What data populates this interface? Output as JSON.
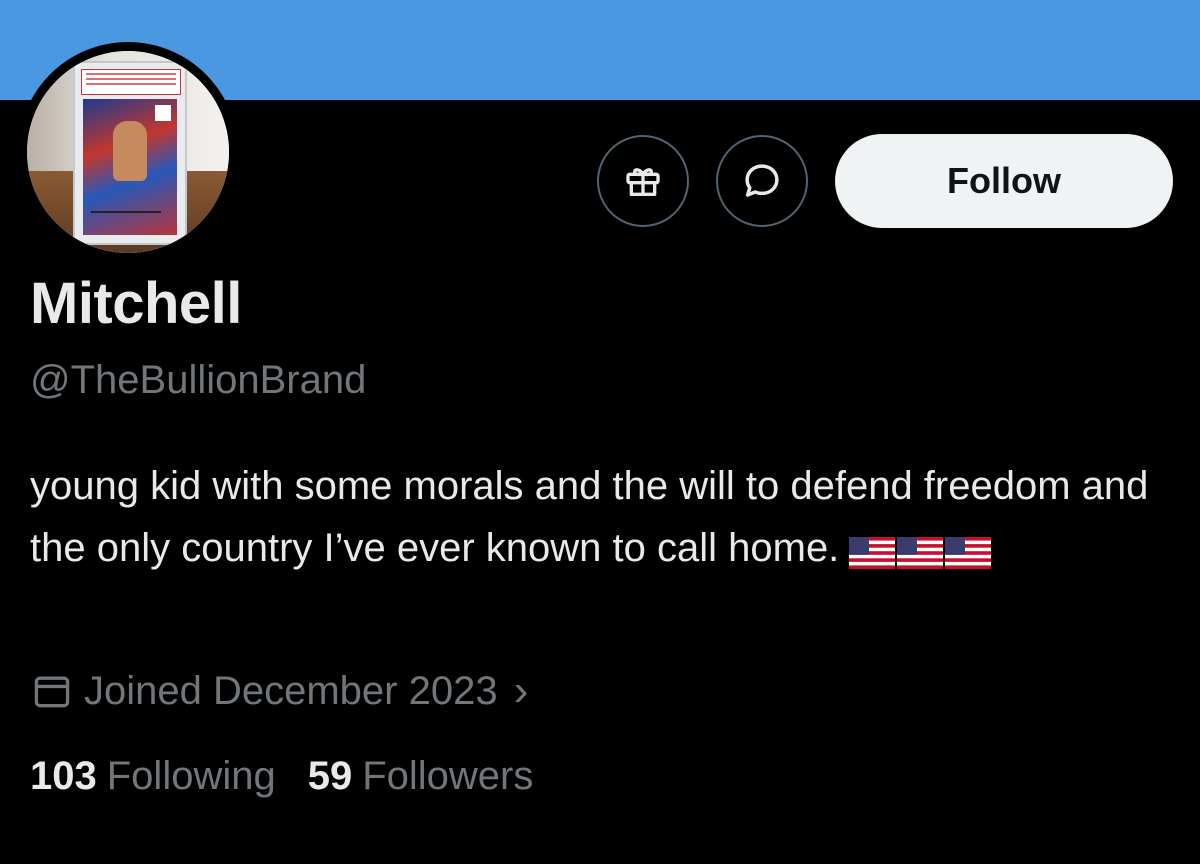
{
  "banner": {
    "color": "#4a98e1"
  },
  "profile": {
    "display_name": "Mitchell",
    "handle": "@TheBullionBrand",
    "bio": "young kid with some morals and the will to defend freedom and the only country I’ve ever known to call home.",
    "bio_emoji": [
      "us-flag-emoji",
      "us-flag-emoji",
      "us-flag-emoji"
    ],
    "joined": "Joined December 2023",
    "joined_chevron": "›"
  },
  "actions": {
    "gift_icon": "gift-icon",
    "message_icon": "message-icon",
    "follow_label": "Follow"
  },
  "stats": {
    "following_count": "103",
    "following_label": "Following",
    "followers_count": "59",
    "followers_label": "Followers"
  },
  "colors": {
    "background": "#000000",
    "primary_text": "#e7e9ea",
    "secondary_text": "#71767b",
    "button_bg": "#eff3f4"
  }
}
